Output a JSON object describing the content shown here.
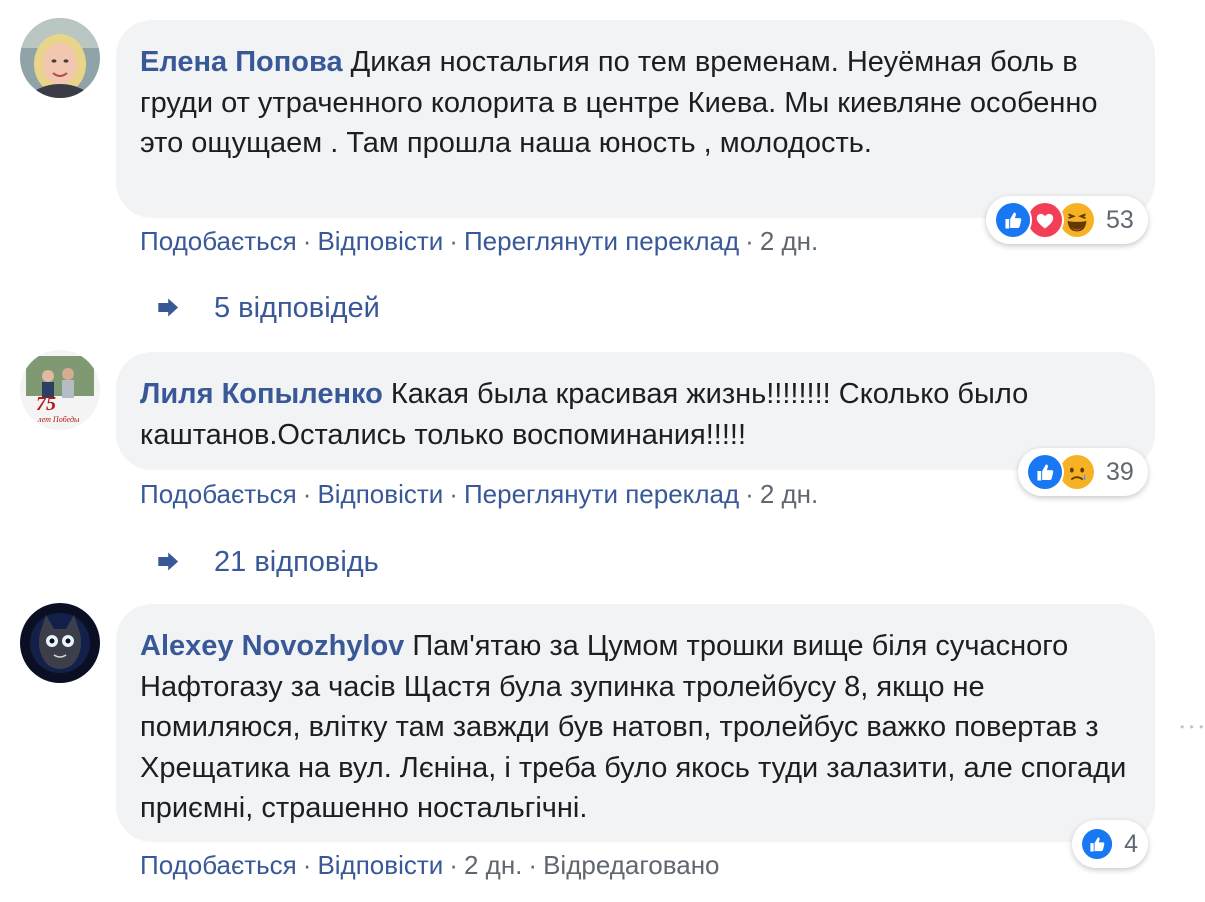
{
  "colors": {
    "link": "#385898",
    "meta": "#606770",
    "bubble": "#f2f3f5",
    "like": "#1877f2",
    "love": "#f33e58",
    "haha": "#f7b125"
  },
  "comments": [
    {
      "author": "Елена Попова",
      "text": "Дикая ностальгия по тем временам. Неуёмная боль в груди от утраченного колорита в центре Киева. Мы киевляне особенно это ощущаем . Там прошла наша юность , молодость.",
      "actions": {
        "like": "Подобається",
        "reply": "Відповісти",
        "translate": "Переглянути переклад",
        "time": "2 дн."
      },
      "reactions": {
        "icons": [
          "like-icon",
          "love-icon",
          "haha-icon"
        ],
        "count": "53"
      },
      "replies": "5 відповідей"
    },
    {
      "author": "Лиля Копыленко",
      "text": "Какая была красивая жизнь!!!!!!!! Сколько было каштанов.Остались только воспоминания!!!!!",
      "avatar_text": [
        "75",
        "лет Победы"
      ],
      "actions": {
        "like": "Подобається",
        "reply": "Відповісти",
        "translate": "Переглянути переклад",
        "time": "2 дн."
      },
      "reactions": {
        "icons": [
          "like-icon",
          "sad-icon"
        ],
        "count": "39"
      },
      "replies": "21 відповідь"
    },
    {
      "author": "Alexey Novozhylov",
      "text": "Пам'ятаю за Цумом трошки вище біля сучасного Нафтогазу за часів Щастя була зупинка тролейбусу 8, якщо не помиляюся, влітку там завжди був натовп, тролейбус важко повертав з Хрещатика на вул. Лєніна, і треба було якось туди залазити, але спогади приємні, страшенно ностальгічні.",
      "actions": {
        "like": "Подобається",
        "reply": "Відповісти",
        "time": "2 дн.",
        "edited": "Відредаговано"
      },
      "reactions": {
        "icons": [
          "like-icon"
        ],
        "count": "4"
      },
      "more_label": "• • •"
    }
  ]
}
